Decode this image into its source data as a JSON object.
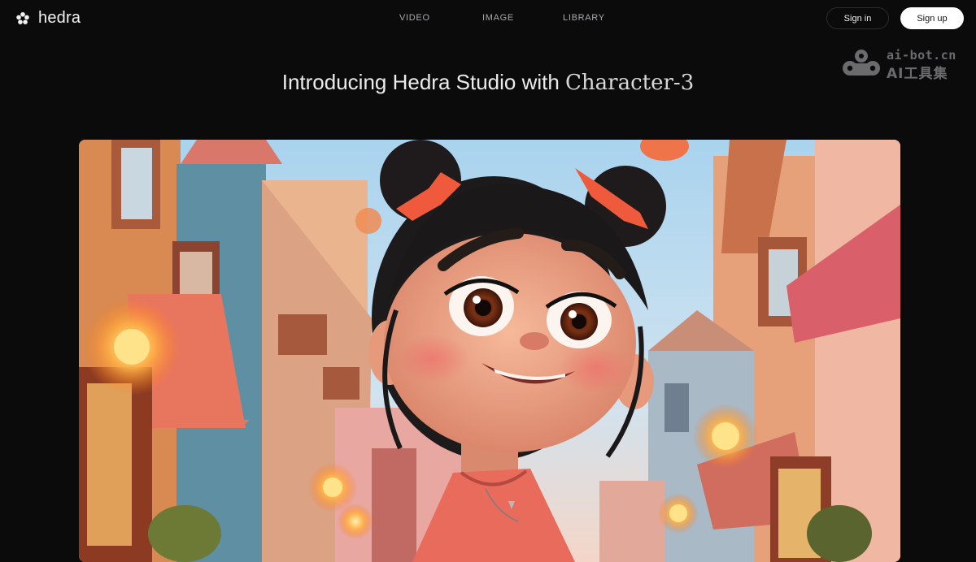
{
  "brand": {
    "name": "hedra",
    "icon": "flower-logo-icon"
  },
  "nav": {
    "links": [
      {
        "label": "VIDEO"
      },
      {
        "label": "IMAGE"
      },
      {
        "label": "LIBRARY"
      }
    ],
    "signin_label": "Sign in",
    "signup_label": "Sign up"
  },
  "watermark": {
    "line1": "ai-bot.cn",
    "line2": "AI工具集",
    "icon": "cloud-logo-icon"
  },
  "headline": {
    "main": "Introducing Hedra Studio with ",
    "accent": "Character-3"
  },
  "hero": {
    "image": "animated-girl-street-illustration"
  },
  "colors": {
    "background": "#0b0b0c",
    "signup_bg": "#ffffff",
    "text": "#ececec",
    "muted": "#a8a8ab"
  }
}
